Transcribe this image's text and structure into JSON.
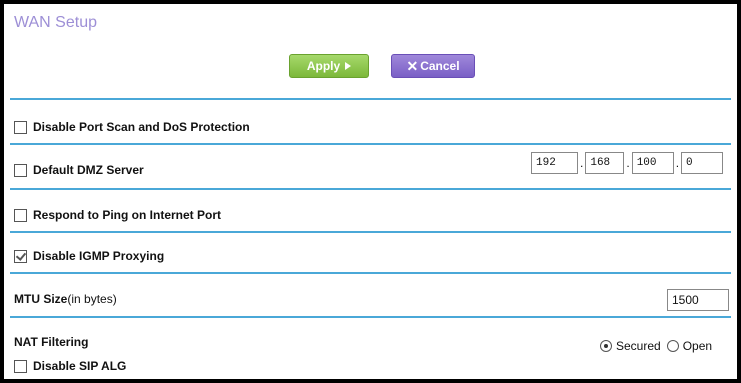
{
  "page": {
    "title": "WAN Setup"
  },
  "buttons": {
    "apply_label": "Apply",
    "cancel_label": "Cancel"
  },
  "options": {
    "port_scan_label": "Disable Port Scan and DoS Protection",
    "port_scan_checked": false,
    "dmz_label": "Default DMZ Server",
    "dmz_checked": false,
    "dmz_ip": [
      "192",
      "168",
      "100",
      "0"
    ],
    "ping_label": "Respond to Ping on Internet Port",
    "ping_checked": false,
    "igmp_label": "Disable IGMP Proxying",
    "igmp_checked": true
  },
  "mtu": {
    "label": "MTU Size",
    "unit": "(in bytes)",
    "value": "1500"
  },
  "nat": {
    "label": "NAT Filtering",
    "secured_label": "Secured",
    "open_label": "Open",
    "selected": "Secured",
    "sip_label": "Disable SIP ALG",
    "sip_checked": false
  },
  "colors": {
    "title": "#9d8fd6",
    "rule": "#4aa8d8",
    "apply": "#7cb83a",
    "cancel": "#7a5fc6"
  }
}
